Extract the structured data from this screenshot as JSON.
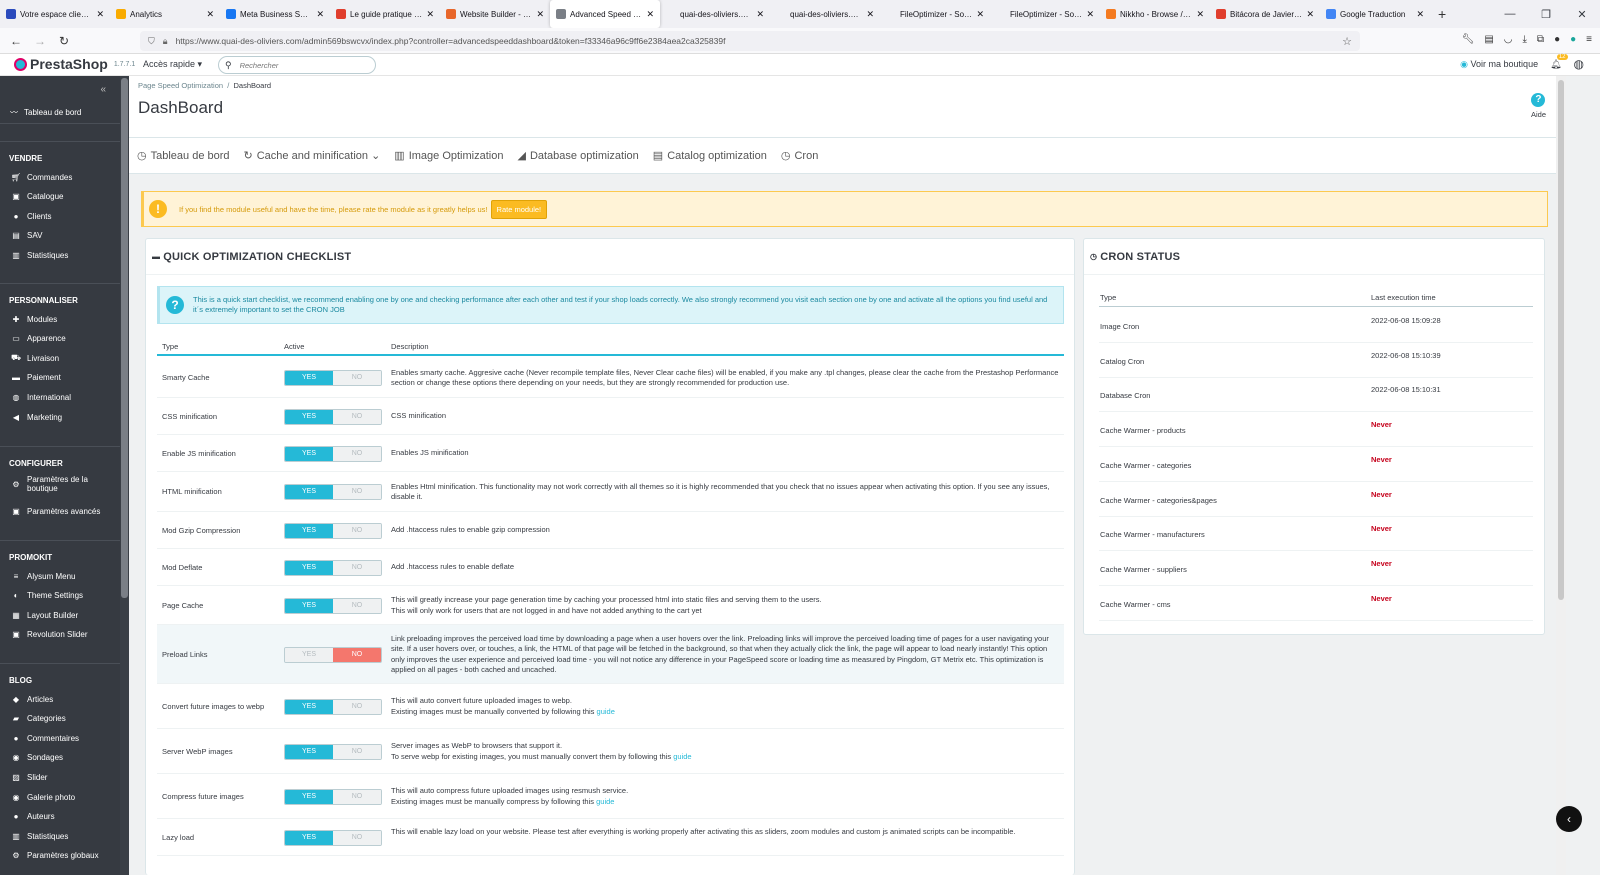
{
  "browser": {
    "tabs": [
      {
        "title": "Votre espace client We",
        "color": "#2b4bbd"
      },
      {
        "title": "Analytics",
        "color": "#f9ab00"
      },
      {
        "title": "Meta Business Suite",
        "color": "#1877f2"
      },
      {
        "title": "Le guide pratique pour",
        "color": "#e03e2d"
      },
      {
        "title": "Website Builder - Médi",
        "color": "#e8662a"
      },
      {
        "title": "Advanced Speed Dashb",
        "color": "#7a7f86"
      },
      {
        "title": "quai-des-oliviers.com/mod",
        "color": ""
      },
      {
        "title": "quai-des-oliviers.com/mod",
        "color": ""
      },
      {
        "title": "FileOptimizer - Software Ja",
        "color": ""
      },
      {
        "title": "FileOptimizer - Software Ja",
        "color": ""
      },
      {
        "title": "Nikkho - Browse /FileO",
        "color": "#f47a20"
      },
      {
        "title": "Bitácora de Javier Gutié",
        "color": "#e03e2d"
      },
      {
        "title": "Google Traduction",
        "color": "#4285f4"
      }
    ],
    "active_tab_index": 5,
    "url": "https://www.quai-des-oliviers.com/admin569bswcvx/index.php?controller=advancedspeeddashboard&token=f33346a96c9ff6e2384aea2ca325839f"
  },
  "header": {
    "logo": "PrestaShop",
    "version": "1.7.7.1",
    "quick_access": "Accès rapide ▾",
    "search_placeholder": "Rechercher",
    "view_shop": "Voir ma boutique",
    "notif_count": "12"
  },
  "sidebar": {
    "dashboard": "Tableau de bord",
    "sections": [
      {
        "title": "VENDRE",
        "items": [
          {
            "label": "Commandes",
            "icon": "cart-icon"
          },
          {
            "label": "Catalogue",
            "icon": "store-icon"
          },
          {
            "label": "Clients",
            "icon": "user-icon"
          },
          {
            "label": "SAV",
            "icon": "chat-icon"
          },
          {
            "label": "Statistiques",
            "icon": "chart-icon"
          }
        ]
      },
      {
        "title": "PERSONNALISER",
        "items": [
          {
            "label": "Modules",
            "icon": "puzzle-icon"
          },
          {
            "label": "Apparence",
            "icon": "monitor-icon"
          },
          {
            "label": "Livraison",
            "icon": "truck-icon"
          },
          {
            "label": "Paiement",
            "icon": "card-icon"
          },
          {
            "label": "International",
            "icon": "globe-icon"
          },
          {
            "label": "Marketing",
            "icon": "megaphone-icon"
          }
        ]
      },
      {
        "title": "CONFIGURER",
        "items": [
          {
            "label": "Paramètres de la boutique",
            "icon": "gear-icon"
          },
          {
            "label": "Paramètres avancés",
            "icon": "settings-box-icon"
          }
        ]
      },
      {
        "title": "PROMOKIT",
        "items": [
          {
            "label": "Alysum Menu",
            "icon": "menu-icon"
          },
          {
            "label": "Theme Settings",
            "icon": "palette-icon"
          },
          {
            "label": "Layout Builder",
            "icon": "layout-icon"
          },
          {
            "label": "Revolution Slider",
            "icon": "slider-icon"
          }
        ]
      },
      {
        "title": "BLOG",
        "items": [
          {
            "label": "Articles",
            "icon": "tag-icon"
          },
          {
            "label": "Categories",
            "icon": "folder-icon"
          },
          {
            "label": "Commentaires",
            "icon": "comments-icon"
          },
          {
            "label": "Sondages",
            "icon": "poll-icon"
          },
          {
            "label": "Slider",
            "icon": "image-icon"
          },
          {
            "label": "Galerie photo",
            "icon": "camera-icon"
          },
          {
            "label": "Auteurs",
            "icon": "author-icon"
          },
          {
            "label": "Statistiques",
            "icon": "chart-icon"
          },
          {
            "label": "Paramètres globaux",
            "icon": "gear-icon"
          }
        ]
      }
    ]
  },
  "page": {
    "breadcrumb_parent": "Page Speed Optimization",
    "breadcrumb_current": "DashBoard",
    "title": "DashBoard",
    "help": "Aide"
  },
  "module_tabs": [
    {
      "label": "Tableau de bord",
      "icon": "dashboard-icon"
    },
    {
      "label": "Cache and minification ⌄",
      "icon": "refresh-icon"
    },
    {
      "label": "Image Optimization",
      "icon": "barcode-icon"
    },
    {
      "label": "Database optimization",
      "icon": "database-icon"
    },
    {
      "label": "Catalog optimization",
      "icon": "catalog-icon"
    },
    {
      "label": "Cron",
      "icon": "clock-icon"
    }
  ],
  "alert": {
    "message": "If you find the module useful and have the time, please rate the module as it greatly helps us!",
    "button": "Rate module!"
  },
  "checklist": {
    "title": "QUICK OPTIMIZATION CHECKLIST",
    "info": "This is a quick start checklist, we recommend enabling one by one and checking performance after each other and test if your shop loads correctly. We also strongly recommend you visit each section one by one and activate all the options you find useful and it´s extremely important to set the CRON JOB",
    "col_type": "Type",
    "col_active": "Active",
    "col_desc": "Description",
    "yes": "YES",
    "no": "NO",
    "rows": [
      {
        "type": "Smarty Cache",
        "active": true,
        "desc": "Enables smarty cache. Aggresive cache (Never recompile template files, Never Clear cache files) will be enabled, if you make any .tpl changes, please clear the cache from the Prestashop Performance section or change these options there depending on your needs, but they are strongly recommended for production use."
      },
      {
        "type": "CSS minification",
        "active": true,
        "desc": "CSS minification"
      },
      {
        "type": "Enable JS minification",
        "active": true,
        "desc": "Enables JS minification"
      },
      {
        "type": "HTML minification",
        "active": true,
        "desc": "Enables Html minification. This functionality may not work correctly with all themes so it is highly recommended that you check that no issues appear when activating this option. If you see any issues, disable it."
      },
      {
        "type": "Mod Gzip Compression",
        "active": true,
        "desc": "Add .htaccess rules to enable gzip compression"
      },
      {
        "type": "Mod Deflate",
        "active": true,
        "desc": "Add .htaccess rules to enable deflate"
      },
      {
        "type": "Page Cache",
        "active": true,
        "desc": "This will greatly increase your page generation time by caching your processed html into static files and serving them to the users.",
        "desc2": "This will only work for users that are not logged in and have not added anything to the cart yet"
      },
      {
        "type": "Preload Links",
        "active": false,
        "desc": "Link preloading improves the perceived load time by downloading a page when a user hovers over the link. Preloading links will improve the perceived loading time of pages for a user navigating your site. If a user hovers over, or touches, a link, the HTML of that page will be fetched in the background, so that when they actually click the link, the page will appear to load nearly instantly! This option only improves the user experience and perceived load time - you will not notice any difference in your PageSpeed score or loading time as measured by Pingdom, GT Metrix etc. This optimization is applied on all pages - both cached and uncached."
      },
      {
        "type": "Convert future images to webp",
        "active": true,
        "desc": "This will auto convert future uploaded images to webp.",
        "desc2": "Existing images must be manually converted by following this",
        "link": "guide"
      },
      {
        "type": "Server WebP images",
        "active": true,
        "desc": "Server images as WebP to browsers that support it.",
        "desc2": "To serve webp for existing images, you must manually convert them by following this",
        "link": "guide"
      },
      {
        "type": "Compress future images",
        "active": true,
        "desc": "This will auto compress future uploaded images using resmush service.",
        "desc2": "Existing images must be manually compress by following this",
        "link": "guide"
      },
      {
        "type": "Lazy load",
        "active": true,
        "desc": "This will enable lazy load on your website. Please test after everything is working properly after activating this as sliders, zoom modules and custom js animated scripts can be incompatible."
      }
    ]
  },
  "cron": {
    "title": "CRON STATUS",
    "col_type": "Type",
    "col_time": "Last execution time",
    "rows": [
      {
        "name": "Image Cron",
        "time": "2022-06-08 15:09:28",
        "never": false
      },
      {
        "name": "Catalog Cron",
        "time": "2022-06-08 15:10:39",
        "never": false
      },
      {
        "name": "Database Cron",
        "time": "2022-06-08 15:10:31",
        "never": false
      },
      {
        "name": "Cache Warmer - products",
        "time": "Never",
        "never": true
      },
      {
        "name": "Cache Warmer - categories",
        "time": "Never",
        "never": true
      },
      {
        "name": "Cache Warmer - categories&pages",
        "time": "Never",
        "never": true
      },
      {
        "name": "Cache Warmer - manufacturers",
        "time": "Never",
        "never": true
      },
      {
        "name": "Cache Warmer - suppliers",
        "time": "Never",
        "never": true
      },
      {
        "name": "Cache Warmer - cms",
        "time": "Never",
        "never": true
      }
    ]
  },
  "colors": {
    "accent": "#25b9d7",
    "warning": "#fbbb22",
    "danger": "#c5001b",
    "sidebar": "#363a41"
  }
}
